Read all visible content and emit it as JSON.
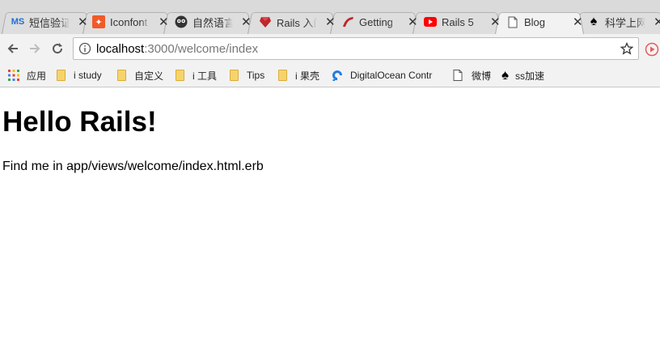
{
  "tabs": [
    {
      "title": "短信验证",
      "favicon": "ms-logo-icon",
      "color": "#1f6fd6"
    },
    {
      "title": "Iconfont",
      "favicon": "iconfont-logo-icon",
      "color": "#f05a28"
    },
    {
      "title": "自然语言",
      "favicon": "owl-icon",
      "color": "#333333"
    },
    {
      "title": "Rails 入门",
      "favicon": "rails-ruby-icon",
      "color": "#c0262b"
    },
    {
      "title": "Getting",
      "favicon": "rails-red-icon",
      "color": "#c0262b"
    },
    {
      "title": "Rails 5",
      "favicon": "youtube-icon",
      "color": "#ff0000"
    },
    {
      "title": "Blog",
      "favicon": "page-icon",
      "color": "#666666",
      "active": true
    },
    {
      "title": "科学上网",
      "favicon": "spade-icon",
      "color": "#000000"
    }
  ],
  "toolbar": {
    "url_host": "localhost",
    "url_rest": ":3000/welcome/index"
  },
  "bookmarks": [
    {
      "label": "应用",
      "icon": "apps-grid-icon"
    },
    {
      "label": "i study",
      "icon": "folder-icon"
    },
    {
      "label": "自定义",
      "icon": "folder-icon"
    },
    {
      "label": "i 工具",
      "icon": "folder-icon"
    },
    {
      "label": "Tips",
      "icon": "folder-icon"
    },
    {
      "label": "i 果壳",
      "icon": "folder-icon"
    },
    {
      "label": "DigitalOcean Contr",
      "icon": "digitalocean-icon"
    },
    {
      "label": "微博",
      "icon": "page-icon"
    },
    {
      "label": "ss加速",
      "icon": "spade-icon"
    }
  ],
  "page": {
    "heading": "Hello Rails!",
    "paragraph": "Find me in app/views/welcome/index.html.erb"
  }
}
